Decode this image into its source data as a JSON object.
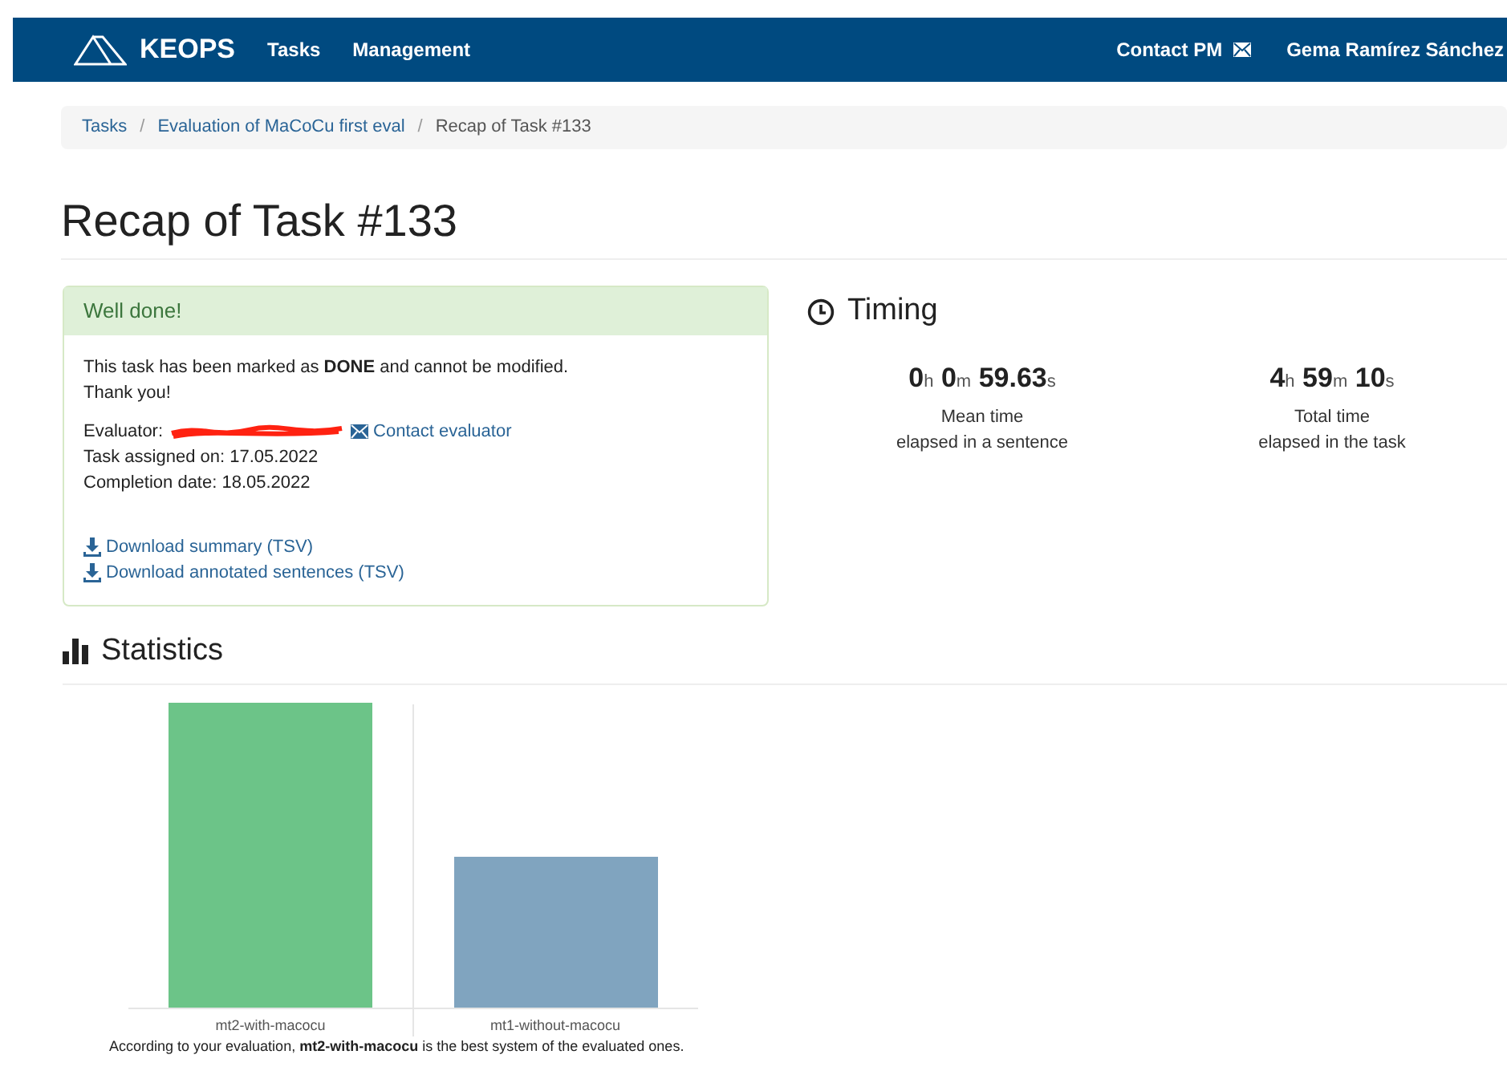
{
  "navbar": {
    "brand": "KEOPS",
    "links": [
      "Tasks",
      "Management"
    ],
    "contact": "Contact PM",
    "user": "Gema Ramírez Sánchez"
  },
  "breadcrumb_separator": "/",
  "breadcrumb": [
    {
      "label": "Tasks",
      "link": true
    },
    {
      "label": "Evaluation of MaCoCu first eval",
      "link": true
    },
    {
      "label": "Recap of Task #133",
      "link": false
    }
  ],
  "title": "Recap of Task #133",
  "status_panel": {
    "heading": "Well done!",
    "message": "This task has been marked as **DONE** and cannot be modified.",
    "thanks": "Thank you!",
    "evaluator_label": "Evaluator:",
    "contact_evaluator": "Contact evaluator",
    "assigned": "Task assigned on: 17.05.2022",
    "completed": "Completion date: 18.05.2022",
    "downloads": [
      "Download summary (TSV)",
      "Download annotated sentences (TSV)"
    ]
  },
  "timing": {
    "heading": "Timing",
    "items": [
      {
        "parts": [
          {
            "value": "0",
            "unit": "h"
          },
          {
            "value": "0",
            "unit": "m"
          },
          {
            "value": "59.63",
            "unit": "s"
          }
        ],
        "caption": [
          "Mean time",
          "elapsed in a sentence"
        ]
      },
      {
        "parts": [
          {
            "value": "4",
            "unit": "h"
          },
          {
            "value": "59",
            "unit": "m"
          },
          {
            "value": "10",
            "unit": "s"
          }
        ],
        "caption": [
          "Total time",
          "elapsed in the task"
        ]
      }
    ]
  },
  "statistics": {
    "heading": "Statistics",
    "categories": [
      "mt2-with-macocu",
      "mt1-without-macocu"
    ],
    "summary": "According to your evaluation, **mt2-with-macocu** is the best system of the evaluated ones."
  }
}
